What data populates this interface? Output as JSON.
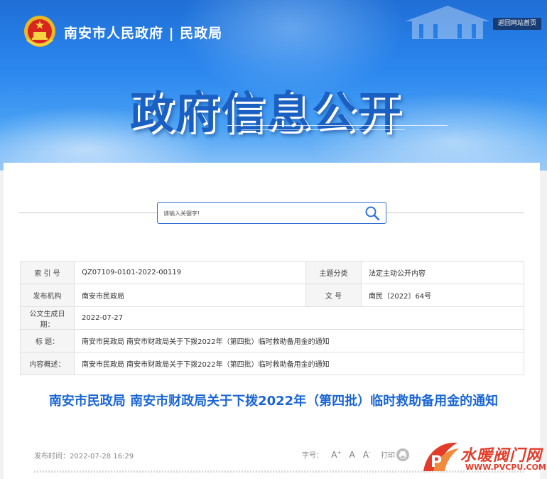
{
  "header": {
    "site_title": "南安市人民政府 | 民政局",
    "home_link": "返回网站首页",
    "big_heading": "政府信息公开"
  },
  "search": {
    "placeholder": "请输入关键字!"
  },
  "meta_table": {
    "index_label": "索 引 号",
    "index_value": "QZ07109-0101-2022-00119",
    "topic_label": "主题分类",
    "topic_value": "法定主动公开内容",
    "publisher_label": "发布机构",
    "publisher_value": "南安市民政局",
    "docno_label": "文 号",
    "docno_value": "南民〔2022〕64号",
    "date_label": "公文生成日期：",
    "date_value": "2022-07-27",
    "title_label": "标 题：",
    "title_value": "南安市民政局 南安市财政局关于下拨2022年（第四批）临时救助备用金的通知",
    "summary_label": "内容概述：",
    "summary_value": "南安市民政局 南安市财政局关于下拨2022年（第四批）临时救助备用金的通知"
  },
  "article": {
    "title": "南安市民政局 南安市财政局关于下拨2022年（第四批）临时救助备用金的通知",
    "publish_time": "发布时间：2022-07-28 16:29",
    "font_size_label": "字号：",
    "font_size_options": [
      "A",
      "A",
      "A"
    ],
    "font_size_marks": [
      "+",
      "",
      "-"
    ],
    "print_label": "打印"
  },
  "watermark": {
    "brand": "水暖阀门网",
    "url": "WWW.PVCPU.COM"
  },
  "colors": {
    "banner_blue": "#2a86ee",
    "title_blue": "#1a66d6",
    "watermark_red": "#e23c2a"
  }
}
